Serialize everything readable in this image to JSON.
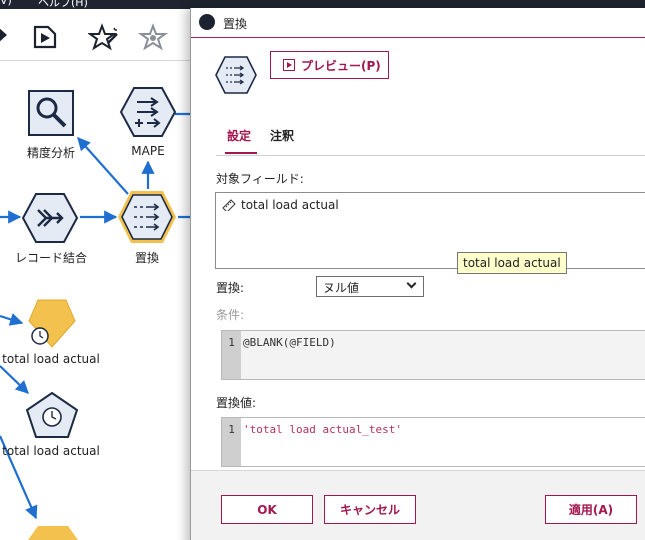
{
  "menubar": {
    "left_fragment": "V)",
    "help_menu": "ヘルプ(H)"
  },
  "toolbar": {
    "icons": [
      "run-icon",
      "run-selection-icon",
      "magic-wand-icon",
      "star-icon"
    ]
  },
  "canvas": {
    "nodes": [
      {
        "label": "精度分析",
        "icon": "magnifier-icon"
      },
      {
        "label": "MAPE",
        "icon": "derive-icon"
      },
      {
        "label": "レコード結合",
        "icon": "merge-icon"
      },
      {
        "label": "置換",
        "icon": "filler-icon"
      },
      {
        "label": "total load actual",
        "icon": "time-intervals-icon"
      },
      {
        "label": "total load actual",
        "icon": "time-plot-icon"
      }
    ]
  },
  "dialog": {
    "title": "置換",
    "preview_button": "プレビュー(P)",
    "tabs": {
      "settings": "設定",
      "annotation": "注釈"
    },
    "target_fields_label": "対象フィールド:",
    "target_fields": [
      "total load actual"
    ],
    "tooltip": "total load actual",
    "replace_label": "置換:",
    "replace_select_value": "ヌル値",
    "condition_label": "条件:",
    "condition_line_no": "1",
    "condition_code": "@BLANK(@FIELD)",
    "replace_value_label": "置換値:",
    "replace_value_line_no": "1",
    "replace_value_code": "'total load actual_test'",
    "ok_button": "OK",
    "cancel_button": "キャンセル",
    "apply_button": "適用(A)"
  },
  "colors": {
    "accent": "#a3164f",
    "node_fill": "#e4ebf5",
    "node_stroke": "#1c2a44",
    "selected_node": "#f2c14e",
    "link": "#1f6fd1",
    "tooltip_bg": "#ffffcc"
  }
}
